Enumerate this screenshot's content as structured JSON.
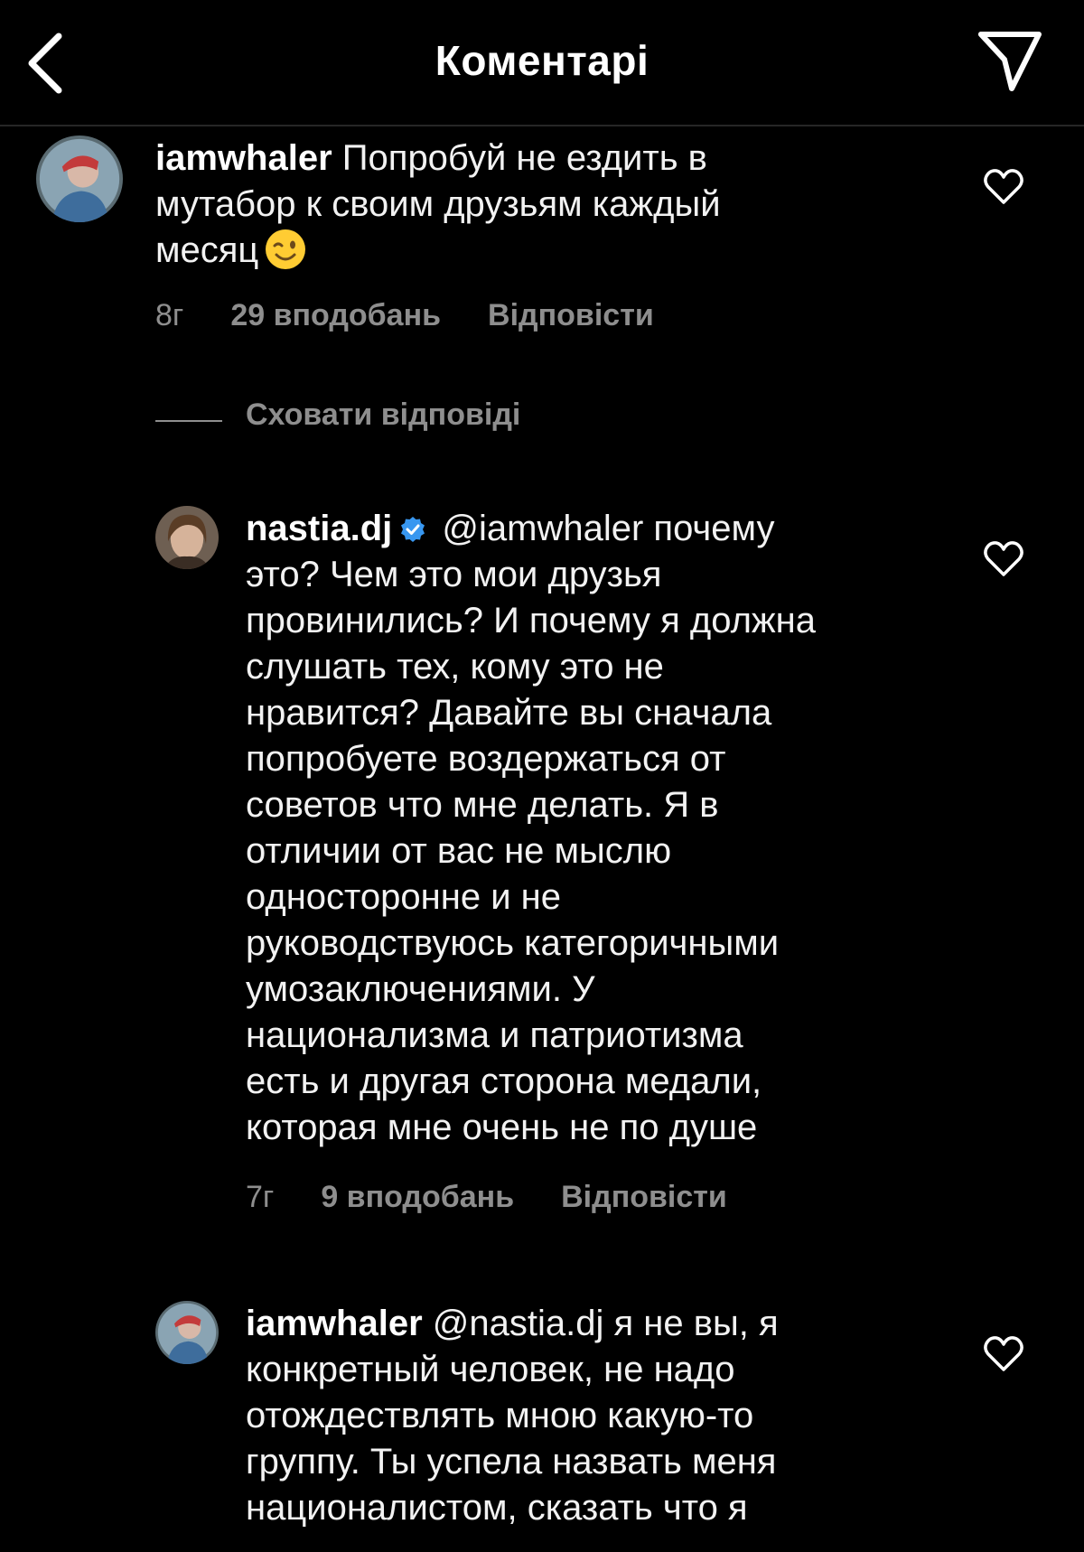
{
  "header": {
    "title": "Коментарі",
    "back_icon": "chevron-left-icon",
    "send_icon": "paper-plane-icon"
  },
  "comments": [
    {
      "username": "iamwhaler",
      "text_lines": [
        "Попробуй не ездить в",
        "мутабор к своим друзьям каждый",
        "месяц"
      ],
      "emoji": "winking-face",
      "time": "8г",
      "likes": "29 вподобань",
      "reply": "Відповісти"
    },
    {
      "username": "nastia.dj",
      "verified": true,
      "mention": "@iamwhaler",
      "text_lines": [
        "почему",
        "это? Чем это мои друзья",
        "провинились? И почему я должна",
        "слушать тех, кому это не",
        "нравится? Давайте вы сначала",
        "попробуете воздержаться от",
        "советов что мне делать. Я в",
        "отличии от вас не мыслю",
        "односторонне и не",
        "руководствуюсь категоричными",
        "умозаключениями. У",
        "национализма и патриотизма",
        "есть и другая сторона медали,",
        "которая мне очень не по душе"
      ],
      "time": "7г",
      "likes": "9 вподобань",
      "reply": "Відповісти"
    },
    {
      "username": "iamwhaler",
      "mention": "@nastia.dj",
      "text_lines": [
        "я не вы, я",
        "конкретный человек, не надо",
        "отождествлять мною какую-то",
        "группу. Ты успела назвать меня",
        "националистом, сказать что я"
      ]
    }
  ],
  "hide_replies_label": "Сховати відповіді",
  "colors": {
    "background": "#000000",
    "secondary_text": "#8e8e8e",
    "verified": "#3897f0"
  }
}
